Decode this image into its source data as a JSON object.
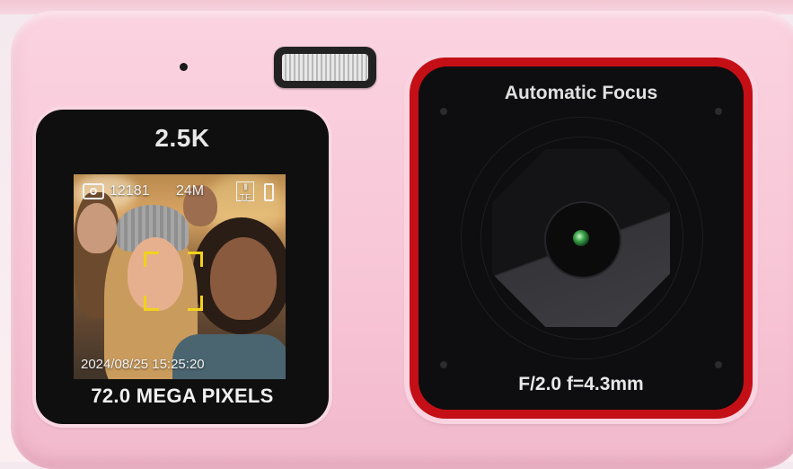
{
  "camera": {
    "body_color": "#f7c5d6",
    "accent_color": "#c40f16",
    "screen": {
      "resolution_label": "2.5K",
      "megapixels_label": "72.0  MEGA PIXELS",
      "hud": {
        "shot_count": "12181",
        "image_size": "24M",
        "storage_label": "TF",
        "timestamp": "2024/08/25 15:25:20",
        "focus_frame_color": "#f2d21b"
      }
    },
    "lens": {
      "top_label": "Automatic Focus",
      "bottom_label": "F/2.0 f=4.3mm"
    }
  }
}
